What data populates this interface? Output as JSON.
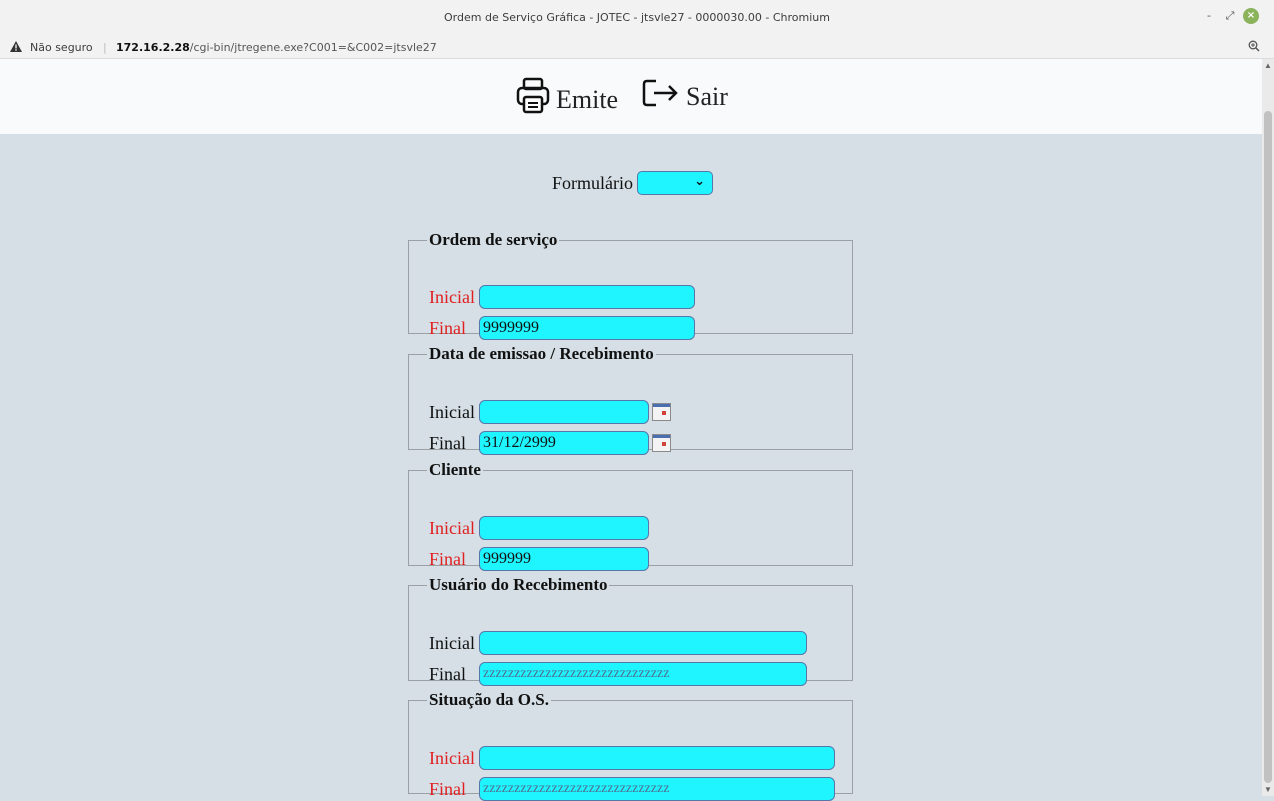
{
  "window": {
    "title": "Ordem de Serviço Gráfica - JOTEC - jtsvle27 - 0000030.00 - Chromium",
    "minimize": "-",
    "restore": "⤢",
    "close": "×"
  },
  "address_bar": {
    "security": "Não seguro",
    "host": "172.16.2.28",
    "path": "/cgi-bin/jtregene.exe?C001=&C002=jtsvle27"
  },
  "toolbar": {
    "emite_label": "Emite",
    "sair_label": "Sair"
  },
  "form": {
    "formulario_label": "Formulário",
    "formulario_value": ""
  },
  "sections": {
    "ordem": {
      "legend": "Ordem de serviço",
      "inicial_label": "Inicial",
      "inicial_value": "",
      "final_label": "Final",
      "final_value": "9999999"
    },
    "data": {
      "legend": "Data de emissao / Recebimento",
      "inicial_label": "Inicial",
      "inicial_value": "",
      "final_label": "Final",
      "final_value": "31/12/2999"
    },
    "cliente": {
      "legend": "Cliente",
      "inicial_label": "Inicial",
      "inicial_value": "",
      "final_label": "Final",
      "final_value": "999999"
    },
    "usuario": {
      "legend": "Usuário do Recebimento",
      "inicial_label": "Inicial",
      "inicial_value": "",
      "final_label": "Final",
      "final_placeholder": "zzzzzzzzzzzzzzzzzzzzzzzzzzzzzz"
    },
    "situacao": {
      "legend": "Situação da O.S.",
      "inicial_label": "Inicial",
      "inicial_value": "",
      "final_label": "Final",
      "final_placeholder": "zzzzzzzzzzzzzzzzzzzzzzzzzzzzzz"
    }
  },
  "colors": {
    "page_bg": "#d5dfe5",
    "input_bg": "#1ef5ff",
    "required_label": "#e02020"
  },
  "icons": {
    "emite": "printer-icon",
    "sair": "exit-icon",
    "calendar": "calendar-icon",
    "warning": "warning-icon",
    "zoom": "zoom-icon"
  }
}
